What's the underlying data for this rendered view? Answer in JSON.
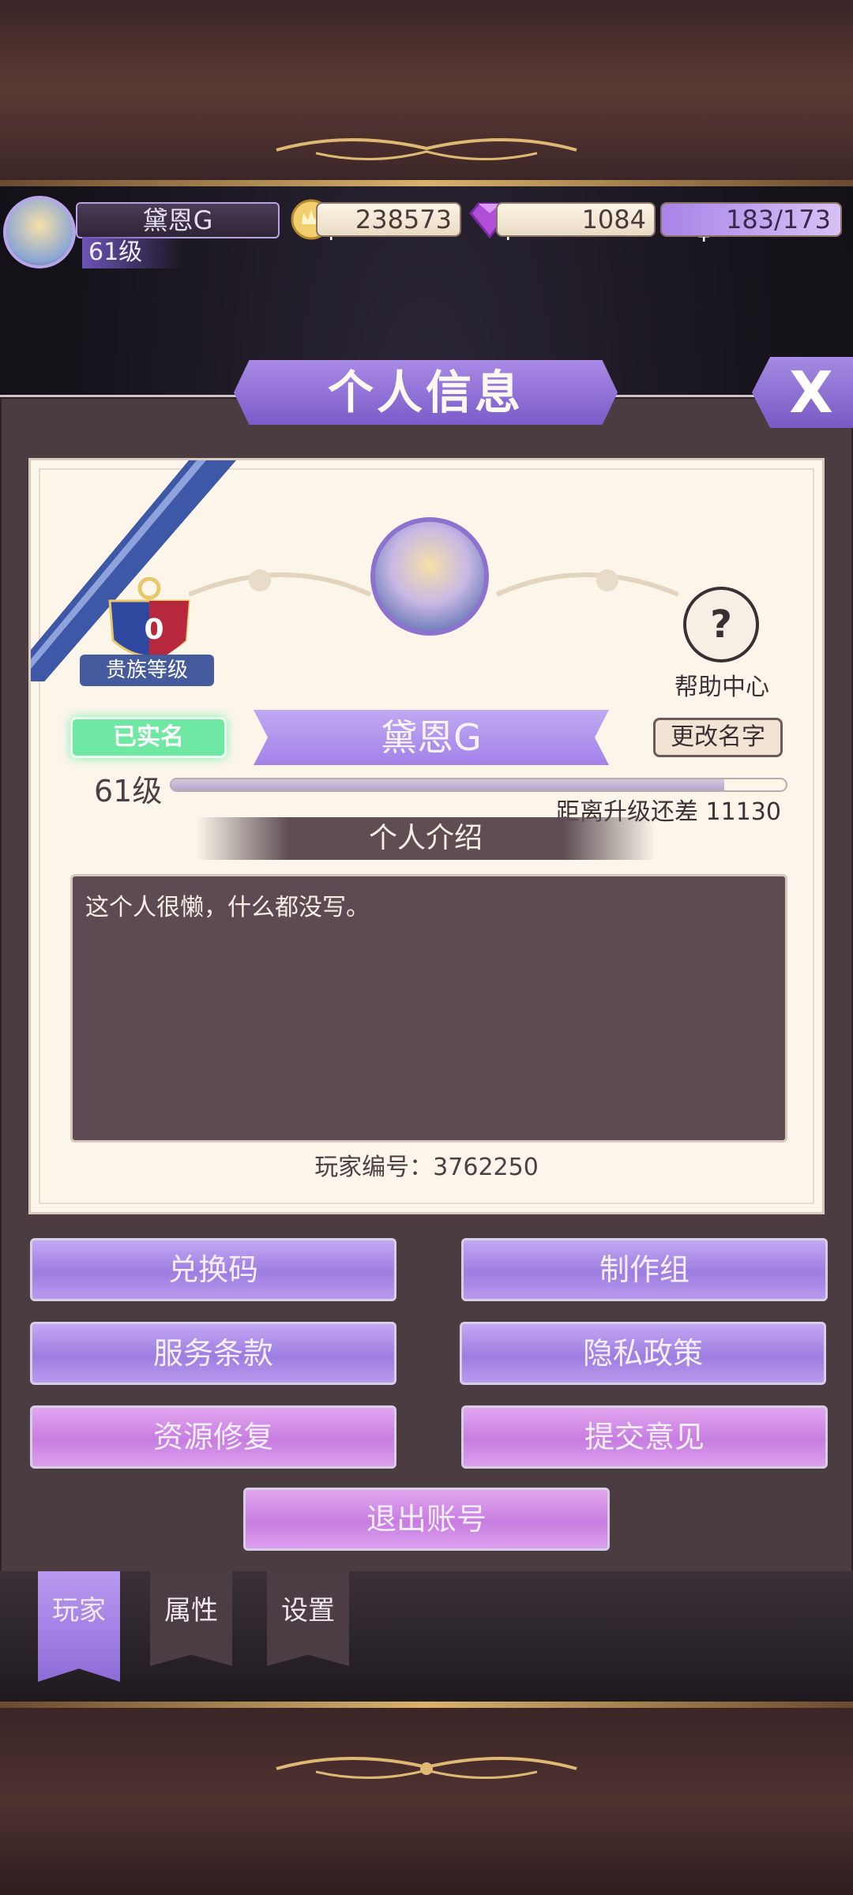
{
  "player": {
    "name": "黛恩G",
    "level": "61级"
  },
  "resources": {
    "gold": "238573",
    "gems": "1084",
    "energy": "183/173"
  },
  "panel": {
    "title": "个人信息",
    "close_label": "X"
  },
  "profile": {
    "noble_level": "0",
    "noble_label": "贵族等级",
    "verified_label": "已实名",
    "name": "黛恩G",
    "rename_label": "更改名字",
    "help_label": "帮助中心",
    "help_glyph": "?",
    "level": "61级",
    "xp_progress": 0.9,
    "xp_remaining": "距离升级还差 11130",
    "intro_header": "个人介绍",
    "intro_text": "这个人很懒，什么都没写。",
    "player_id": "玩家编号：3762250"
  },
  "menu": {
    "redeem": "兑换码",
    "credits": "制作组",
    "terms": "服务条款",
    "privacy": "隐私政策",
    "repair": "资源修复",
    "feedback": "提交意见",
    "logout": "退出账号"
  },
  "tabs": [
    {
      "label": "玩家",
      "active": true
    },
    {
      "label": "属性",
      "active": false
    },
    {
      "label": "设置",
      "active": false
    }
  ],
  "colors": {
    "accent_purple": "#9d7de0",
    "accent_pink": "#c77de0",
    "verified_green": "#6ee8a2"
  }
}
